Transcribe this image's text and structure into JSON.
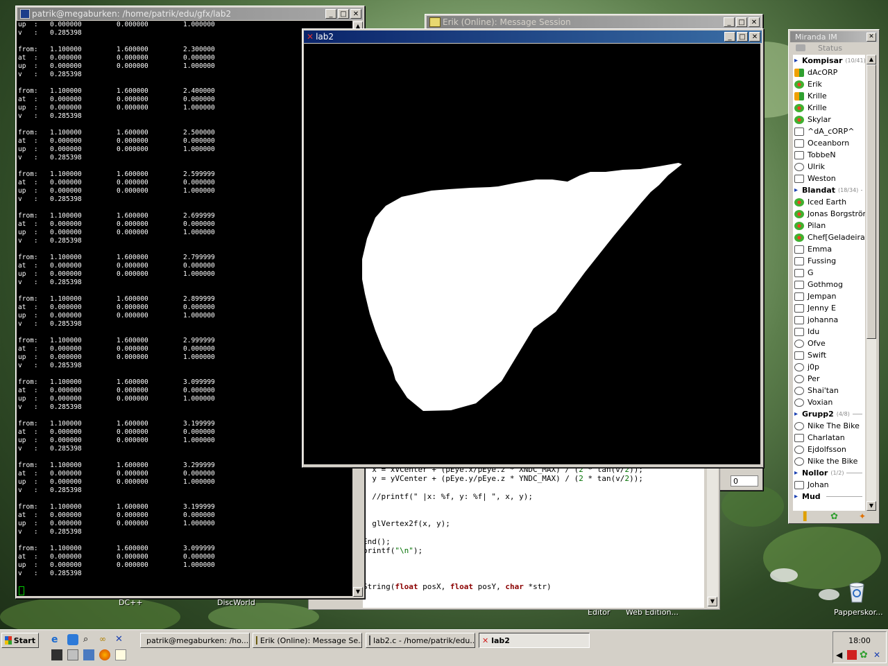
{
  "terminal": {
    "title": "patrik@megaburken: /home/patrik/edu/gfx/lab2",
    "top_lines": [
      {
        "k": "up  :",
        "c1": "0.000000",
        "c2": "0.000000",
        "c3": "1.000000"
      },
      {
        "k": "v   :",
        "c1": "0.285398",
        "c2": "",
        "c3": ""
      }
    ],
    "blocks": [
      {
        "from": "2.300000"
      },
      {
        "from": "2.400000"
      },
      {
        "from": "2.500000"
      },
      {
        "from": "2.599999"
      },
      {
        "from": "2.699999"
      },
      {
        "from": "2.799999"
      },
      {
        "from": "2.899999"
      },
      {
        "from": "2.999999"
      },
      {
        "from": "3.099999"
      },
      {
        "from": "3.199999"
      },
      {
        "from": "3.299999"
      },
      {
        "from": "3.199999"
      },
      {
        "from": "3.099999"
      }
    ],
    "labels": {
      "from": "from:",
      "at": "at  :",
      "up": "up  :",
      "v": "v   :"
    },
    "from_x": "1.100000",
    "from_y": "1.600000",
    "zero": "0.000000",
    "one": "1.000000",
    "v": "0.285398"
  },
  "msgsession": {
    "title": "Erik (Online): Message Session",
    "counter": "0"
  },
  "lab2": {
    "title": "lab2"
  },
  "editor": {
    "lines": [
      [
        {
          "t": "  x = xVCenter + (pEye.x/pEye.z * XNDC_MAX) / ("
        },
        {
          "t": "2",
          "c": "num"
        },
        {
          "t": " * tan(v/"
        },
        {
          "t": "2",
          "c": "num"
        },
        {
          "t": "));"
        }
      ],
      [
        {
          "t": "  y = yVCenter + (pEye.y/pEye.z * YNDC_MAX) / ("
        },
        {
          "t": "2",
          "c": "num"
        },
        {
          "t": " * tan(v/"
        },
        {
          "t": "2",
          "c": "num"
        },
        {
          "t": "));"
        }
      ],
      [
        {
          "t": ""
        }
      ],
      [
        {
          "t": "  //printf(\" |x: %f, y: %f| \", x, y);"
        }
      ],
      [
        {
          "t": ""
        }
      ],
      [
        {
          "t": ""
        }
      ],
      [
        {
          "t": "  glVertex2f(x, y);"
        }
      ],
      [
        {
          "t": ""
        }
      ],
      [
        {
          "t": "End();"
        }
      ],
      [
        {
          "t": "printf("
        },
        {
          "t": "\"\\n\"",
          "c": "str"
        },
        {
          "t": ");"
        }
      ],
      [
        {
          "t": ""
        }
      ],
      [
        {
          "t": ""
        }
      ],
      [
        {
          "t": ""
        }
      ],
      [
        {
          "t": "String("
        },
        {
          "t": "float",
          "c": "kw"
        },
        {
          "t": " posX, "
        },
        {
          "t": "float",
          "c": "kw"
        },
        {
          "t": " posY, "
        },
        {
          "t": "char",
          "c": "kw"
        },
        {
          "t": " *str)"
        }
      ]
    ]
  },
  "miranda": {
    "title": "Miranda IM",
    "status_label": "Status",
    "items": [
      {
        "type": "group",
        "name": "Kompisar",
        "count": "(10/41)"
      },
      {
        "type": "contact",
        "name": "dAcORP",
        "icon": "msn-online"
      },
      {
        "type": "contact",
        "name": "Erik",
        "icon": "icq-online"
      },
      {
        "type": "contact",
        "name": "Krille",
        "icon": "msn-online"
      },
      {
        "type": "contact",
        "name": "Krille",
        "icon": "icq-online"
      },
      {
        "type": "contact",
        "name": "Skylar",
        "icon": "icq-online"
      },
      {
        "type": "contact",
        "name": "^dA_cORP^",
        "icon": "offline"
      },
      {
        "type": "contact",
        "name": "Oceanborn",
        "icon": "offline"
      },
      {
        "type": "contact",
        "name": "TobbeN",
        "icon": "offline"
      },
      {
        "type": "contact",
        "name": "Ulrik",
        "icon": "away"
      },
      {
        "type": "contact",
        "name": "Weston",
        "icon": "offline"
      },
      {
        "type": "group",
        "name": "Blandat",
        "count": "(18/34)"
      },
      {
        "type": "contact",
        "name": "Iced Earth",
        "icon": "icq-online"
      },
      {
        "type": "contact",
        "name": "Jonas Borgström",
        "icon": "icq-online"
      },
      {
        "type": "contact",
        "name": "Pilan",
        "icon": "icq-online"
      },
      {
        "type": "contact",
        "name": "Chef[Geladeira]",
        "icon": "icq-online"
      },
      {
        "type": "contact",
        "name": "Emma",
        "icon": "offline"
      },
      {
        "type": "contact",
        "name": "Fussing",
        "icon": "offline"
      },
      {
        "type": "contact",
        "name": "G",
        "icon": "offline"
      },
      {
        "type": "contact",
        "name": "Gothmog",
        "icon": "offline"
      },
      {
        "type": "contact",
        "name": "Jempan",
        "icon": "offline"
      },
      {
        "type": "contact",
        "name": "Jenny E",
        "icon": "offline"
      },
      {
        "type": "contact",
        "name": "johanna",
        "icon": "offline"
      },
      {
        "type": "contact",
        "name": "Idu",
        "icon": "offline"
      },
      {
        "type": "contact",
        "name": "Ofve",
        "icon": "away"
      },
      {
        "type": "contact",
        "name": "Swift",
        "icon": "offline"
      },
      {
        "type": "contact",
        "name": "j0p",
        "icon": "away"
      },
      {
        "type": "contact",
        "name": "Per",
        "icon": "away"
      },
      {
        "type": "contact",
        "name": "Shai'tan",
        "icon": "away"
      },
      {
        "type": "contact",
        "name": "Voxian",
        "icon": "away"
      },
      {
        "type": "group",
        "name": "Grupp2",
        "count": "(4/8)"
      },
      {
        "type": "contact",
        "name": "Nike The Bike",
        "icon": "away"
      },
      {
        "type": "contact",
        "name": "Charlatan",
        "icon": "offline"
      },
      {
        "type": "contact",
        "name": "Ejdolfsson",
        "icon": "away"
      },
      {
        "type": "contact",
        "name": "Nike the Bike",
        "icon": "away"
      },
      {
        "type": "group",
        "name": "Nollor",
        "count": "(1/2)"
      },
      {
        "type": "contact",
        "name": "Johan",
        "icon": "offline"
      },
      {
        "type": "group",
        "name": "Mud",
        "count": ""
      }
    ]
  },
  "desktop": {
    "labels": [
      "DC++",
      "DiscWorld",
      "Editor",
      "Web Edition...",
      "Papperskor..."
    ]
  },
  "taskbar": {
    "start": "Start",
    "tasks": [
      "patrik@megaburken: /ho...",
      "Erik (Online): Message Se...",
      "lab2.c - /home/patrik/edu...",
      "lab2"
    ],
    "clock": "18:00"
  },
  "colors": {
    "accent": "#0a246a",
    "canvas": "#000000",
    "shape": "#ffffff"
  }
}
